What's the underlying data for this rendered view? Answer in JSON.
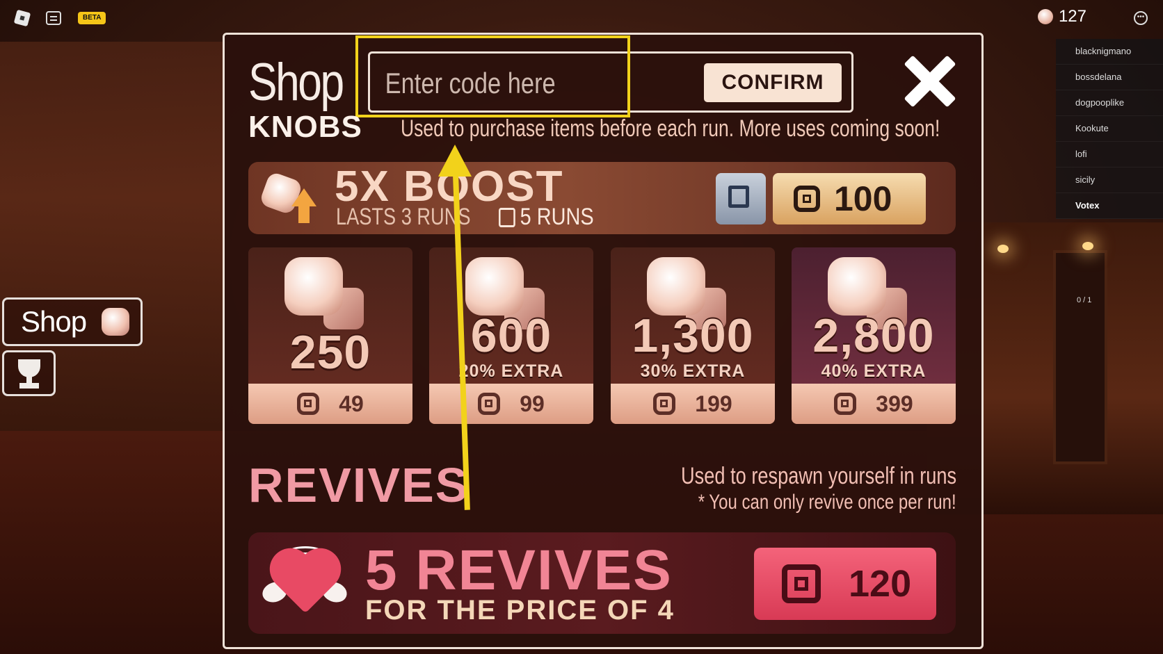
{
  "topbar": {
    "beta_label": "BETA",
    "knob_count": "127"
  },
  "players": [
    "blacknigmano",
    "bossdelana",
    "dogpooplike",
    "Kookute",
    "lofi",
    "sicily",
    "Votex"
  ],
  "counter": "0 / 1",
  "side": {
    "shop_label": "Shop"
  },
  "shop": {
    "title": "Shop",
    "code_placeholder": "Enter code here",
    "confirm_label": "CONFIRM",
    "knobs_heading": "KNOBS",
    "knobs_description": "Used to purchase items before each run. More uses coming soon!",
    "boost": {
      "title": "5X BOOST",
      "subtitle": "LASTS 3 RUNS",
      "runs_label": "5 RUNS",
      "price": "100"
    },
    "knob_packs": [
      {
        "amount": "250",
        "extra": "",
        "price": "49"
      },
      {
        "amount": "600",
        "extra": "20% EXTRA",
        "price": "99"
      },
      {
        "amount": "1,300",
        "extra": "30% EXTRA",
        "price": "199"
      },
      {
        "amount": "2,800",
        "extra": "40% EXTRA",
        "price": "399"
      }
    ],
    "revives_heading": "REVIVES",
    "revives_description": "Used to respawn yourself in runs",
    "revives_note": "* You can only revive once per run!",
    "revive_offer": {
      "title": "5 REVIVES",
      "subtitle": "FOR THE PRICE OF 4",
      "price": "120"
    }
  },
  "colors": {
    "highlight": "#f2d21b",
    "revive_accent": "#f18595",
    "price_red": "#e84a64"
  }
}
